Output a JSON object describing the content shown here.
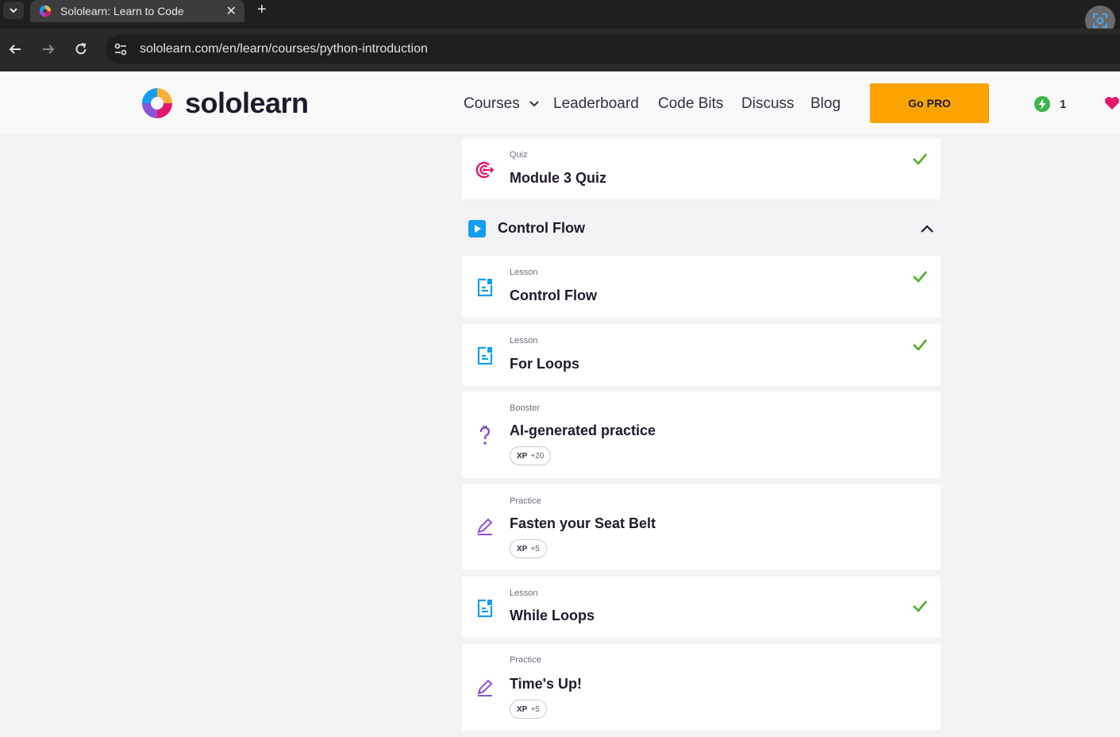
{
  "browser": {
    "tab_title": "Sololearn: Learn to Code",
    "url": "sololearn.com/en/learn/courses/python-introduction"
  },
  "header": {
    "logo_text": "sololearn",
    "nav": {
      "courses": "Courses",
      "leaderboard": "Leaderboard",
      "code_bits": "Code Bits",
      "discuss": "Discuss",
      "blog": "Blog"
    },
    "go_pro": "Go PRO",
    "streak_count": "1"
  },
  "colors": {
    "go_pro_bg": "#fba300",
    "check": "#4caf23",
    "lesson_icon": "#149ef2",
    "quiz_icon": "#e5176b",
    "practice_icon": "#8a54d9"
  },
  "quiz_card": {
    "type": "Quiz",
    "title": "Module 3 Quiz",
    "icon": "target-icon",
    "completed": true
  },
  "module": {
    "title": "Control Flow",
    "expanded": true
  },
  "items": [
    {
      "type": "Lesson",
      "title": "Control Flow",
      "icon": "lesson-icon",
      "completed": true
    },
    {
      "type": "Lesson",
      "title": "For Loops",
      "icon": "lesson-icon",
      "completed": true
    },
    {
      "type": "Booster",
      "title": "AI-generated practice",
      "icon": "question-icon",
      "xp_label": "XP",
      "xp_value": "+20",
      "completed": false
    },
    {
      "type": "Practice",
      "title": "Fasten your Seat Belt",
      "icon": "pencil-icon",
      "xp_label": "XP",
      "xp_value": "+5",
      "completed": false
    },
    {
      "type": "Lesson",
      "title": "While Loops",
      "icon": "lesson-icon",
      "completed": true
    },
    {
      "type": "Practice",
      "title": "Time's Up!",
      "icon": "pencil-icon",
      "xp_label": "XP",
      "xp_value": "+5",
      "completed": false
    }
  ]
}
